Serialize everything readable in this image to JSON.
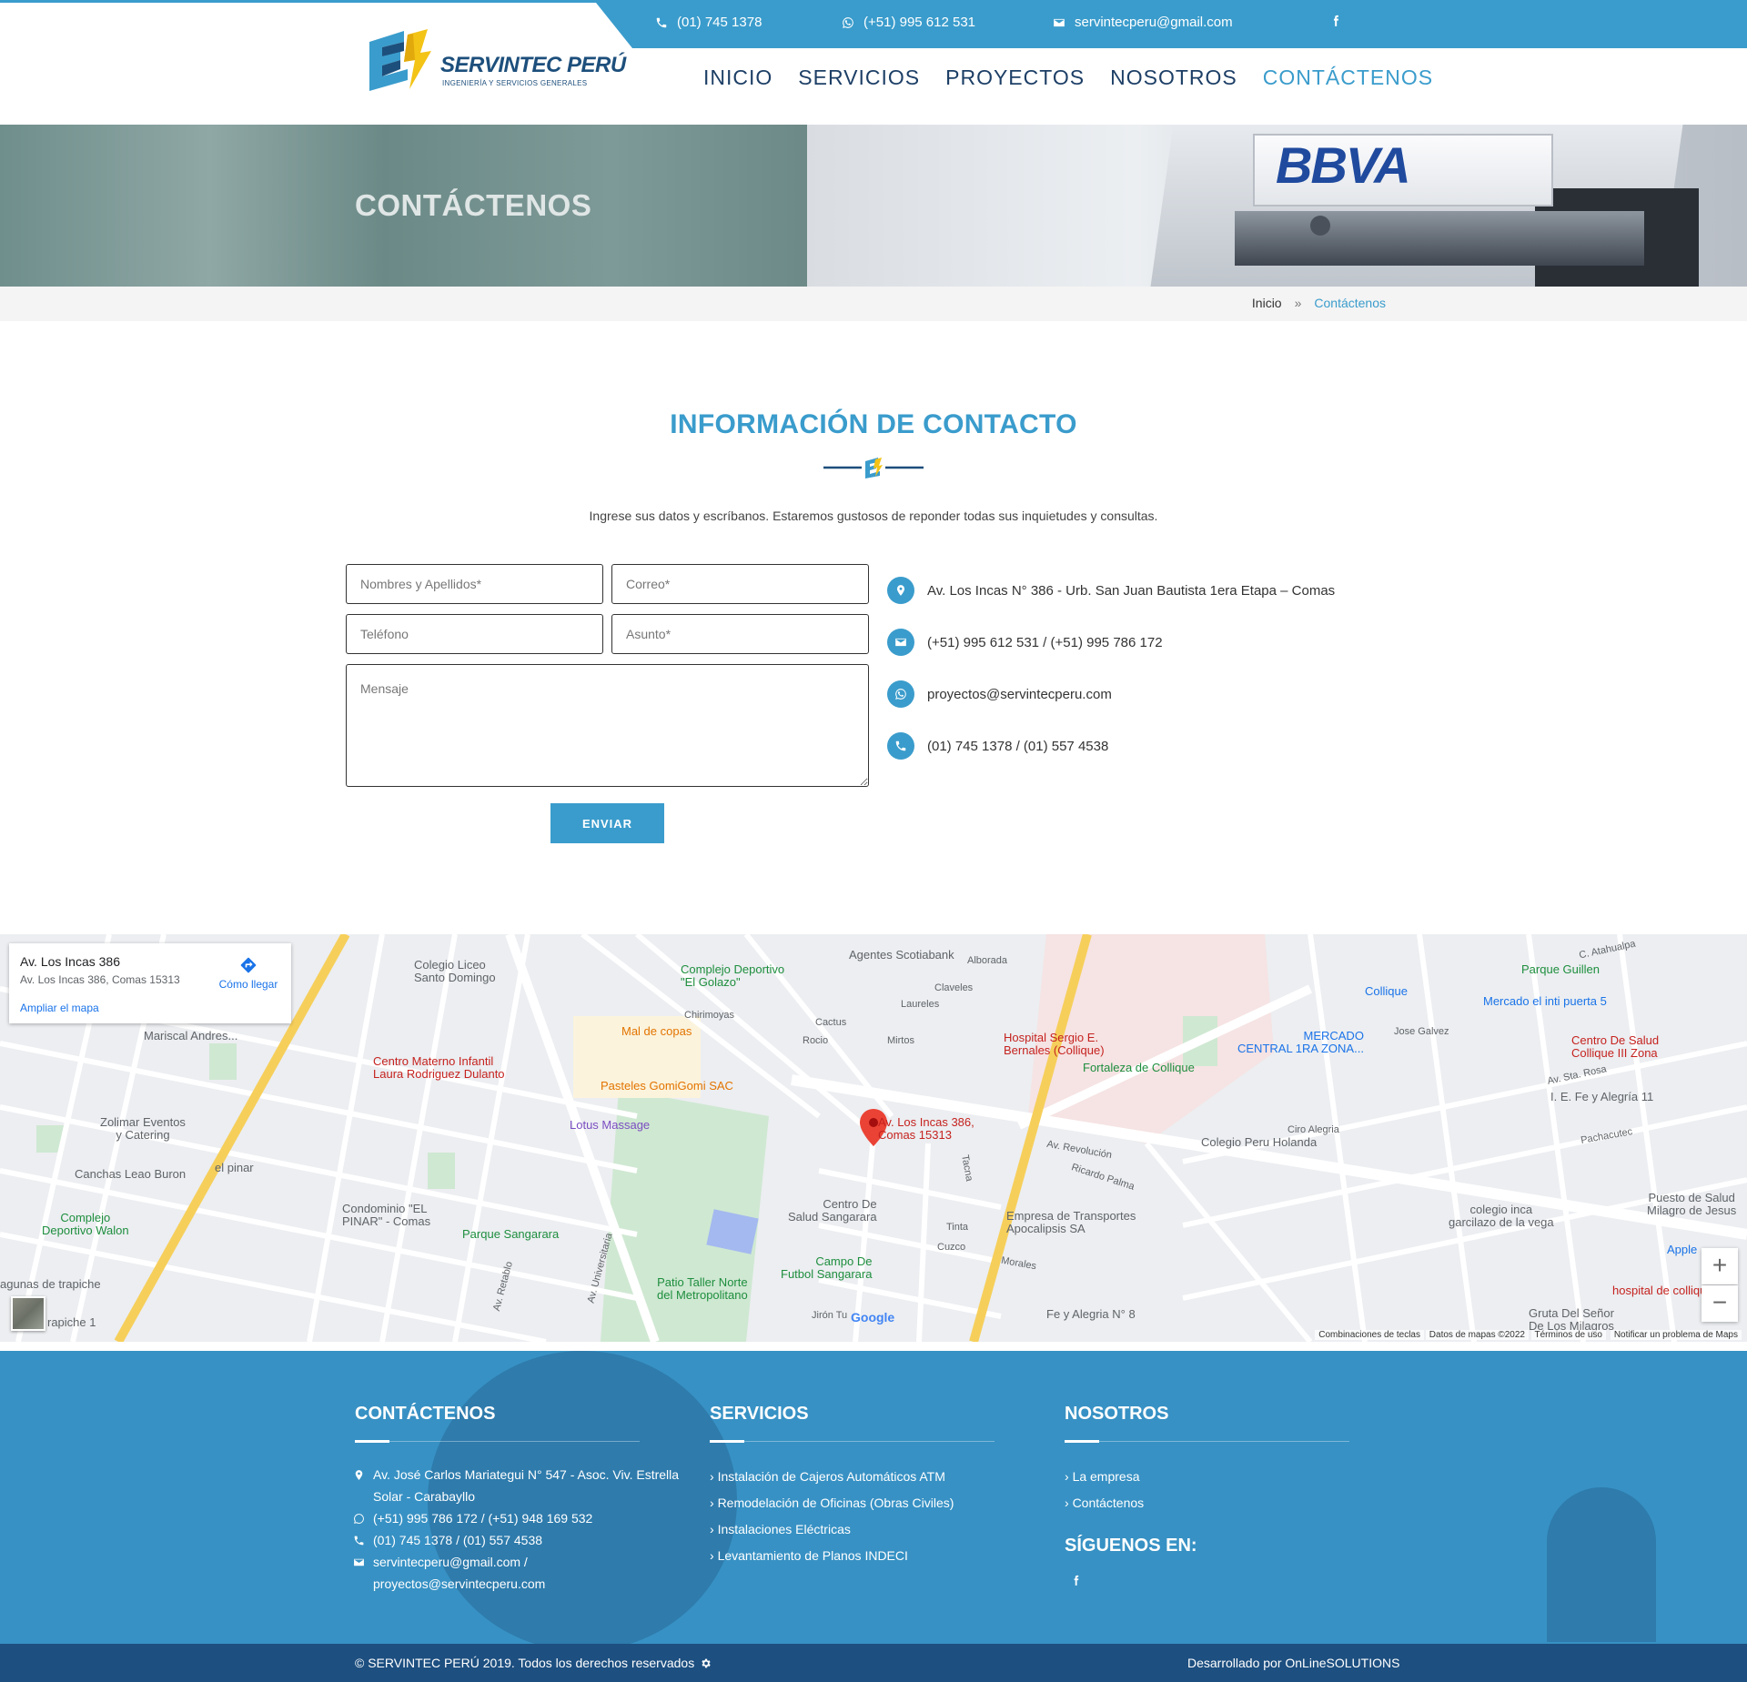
{
  "topbar": {
    "phone": "(01) 745 1378",
    "whatsapp": "(+51) 995 612 531",
    "email": "servintecperu@gmail.com"
  },
  "logo": {
    "name": "SERVINTEC PERÚ",
    "tagline": "INGENIERÍA Y SERVICIOS GENERALES"
  },
  "nav": {
    "items": [
      {
        "label": "INICIO"
      },
      {
        "label": "SERVICIOS"
      },
      {
        "label": "PROYECTOS"
      },
      {
        "label": "NOSOTROS"
      },
      {
        "label": "CONTÁCTENOS",
        "active": true
      }
    ]
  },
  "hero": {
    "title": "CONTÁCTENOS",
    "photo_text": "BBVA"
  },
  "breadcrumb": {
    "home": "Inicio",
    "separator": "»",
    "current": "Contáctenos"
  },
  "contact": {
    "title": "INFORMACIÓN DE CONTACTO",
    "intro": "Ingrese sus datos y escríbanos. Estaremos gustosos de reponder todas sus inquietudes y consultas.",
    "form": {
      "name_placeholder": "Nombres y Apellidos*",
      "email_placeholder": "Correo*",
      "phone_placeholder": "Teléfono",
      "subject_placeholder": "Asunto*",
      "message_placeholder": "Mensaje",
      "submit_label": "ENVIAR"
    },
    "info": {
      "address": "Av. Los Incas N° 386 - Urb. San Juan Bautista 1era Etapa – Comas",
      "phones": "(+51) 995 612 531 / (+51) 995 786 172",
      "email": "proyectos@servintecperu.com",
      "landlines": "(01) 745 1378 / (01) 557 4538"
    }
  },
  "map": {
    "card": {
      "title": "Av. Los Incas 386",
      "address": "Av. Los Incas 386, Comas 15313",
      "directions": "Cómo llegar",
      "enlarge": "Ampliar el mapa"
    },
    "marker_label": "Av. Los Incas 386,\nComas 15313",
    "labels": {
      "colegio_liceo": "Colegio Liceo\nSanto Domingo",
      "complejo_golazo": "Complejo Deportivo\n\"El Golazo\"",
      "scotiabank": "Agentes Scotiabank",
      "alborada": "Alborada",
      "claveles": "Claveles",
      "laureles": "Laureles",
      "mirtos": "Mirtos",
      "cactus": "Cactus",
      "rocio": "Rocio",
      "mal_de_copas": "Mal de copas",
      "chirimoyas": "Chirimoyas",
      "pasteles": "Pasteles GomiGomi SAC",
      "centro_materno": "Centro Materno Infantil\nLaura Rodriguez Dulanto",
      "lotus": "Lotus Massage",
      "hospital": "Hospital Sergio E.\nBernales (Collique)",
      "fortaleza": "Fortaleza de Collique",
      "mercado": "MERCADO\nCENTRAL 1RA ZONA...",
      "parque_guillen": "Parque Guillen",
      "mercado_inti": "Mercado el inti puerta 5",
      "centro_salud_collique": "Centro De Salud\nCollique III Zona",
      "iefe": "I. E. Fe y Alegría 11",
      "collique": "Collique",
      "colegio_holanda": "Colegio Peru Holanda",
      "ciro": "Ciro Alegria",
      "zolimar": "Zolimar Eventos\ny Catering",
      "canchas": "Canchas Leao Buron",
      "el_pinar": "el pinar",
      "complejo_walon": "Complejo\nDeportivo Walon",
      "condominio": "Condominio \"EL\nPINAR\" - Comas",
      "parque_sangarara": "Parque Sangarara",
      "centro_sangarara": "Centro De\nSalud Sangarara",
      "empresa_transportes": "Empresa de Transportes\nApocalipsis SA",
      "campo_futbol": "Campo De\nFutbol Sangarara",
      "patio_taller": "Patio Taller Norte\ndel Metropolitano",
      "fe_alegria_8": "Fe y Alegria N° 8",
      "colegio_inca": "colegio inca\ngarcilazo de la vega",
      "puesto_salud": "Puesto de Salud\nMilagro de Jesus",
      "hospital_collique": "hospital de collique",
      "gruta": "Gruta Del Señor\nDe Los Milagros",
      "apple": "Apple",
      "lagunas": "agunas de trapiche",
      "trapiche": "rapiche 1",
      "mariscal": "Mariscal Andres...",
      "av_revolucion": "Av. Revolución",
      "av_universitaria": "Av. Universitaria",
      "av_retablo": "Av. Retablo",
      "ricardo_palma": "Ricardo Palma",
      "jose_galvez": "Jose Galvez",
      "sta_rosa": "Av. Sta. Rosa",
      "calle_alahualpa": "C. Atahualpa",
      "pachacutec": "Pachacutec",
      "el_salvador": "Tacna",
      "jiron_tu": "Jirón Tu",
      "morales": "Morales",
      "cuzco": "Cuzco",
      "tinta": "Tinta"
    },
    "attribution": {
      "shortcuts": "Combinaciones de teclas",
      "data": "Datos de mapas ©2022",
      "terms": "Términos de uso",
      "report": "Notificar un problema de Maps"
    },
    "google": "Google",
    "zoom_in": "+",
    "zoom_out": "−"
  },
  "footer": {
    "contact": {
      "heading": "CONTÁCTENOS",
      "address": "Av. José Carlos Mariategui N° 547 - Asoc. Viv. Estrella Solar - Carabayllo",
      "whatsapp": "(+51) 995 786 172 / (+51) 948 169 532",
      "phones": "(01) 745 1378 / (01) 557 4538",
      "emails": "servintecperu@gmail.com / proyectos@servintecperu.com"
    },
    "services": {
      "heading": "SERVICIOS",
      "items": [
        "Instalación de Cajeros Automáticos ATM",
        "Remodelación de Oficinas (Obras Civiles)",
        "Instalaciones Eléctricas",
        "Levantamiento de Planos INDECI"
      ]
    },
    "about": {
      "heading": "NOSOTROS",
      "items": [
        "La empresa",
        "Contáctenos"
      ],
      "follow_heading": "SÍGUENOS EN:"
    },
    "copyright": "© SERVINTEC PERÚ 2019. Todos los derechos reservados",
    "developer": "Desarrollado por OnLineSOLUTIONS"
  },
  "colors": {
    "accent": "#3a9ccc",
    "navy": "#1d3f66",
    "footer": "#3791c4",
    "footer_bottom": "#1d4f80"
  }
}
